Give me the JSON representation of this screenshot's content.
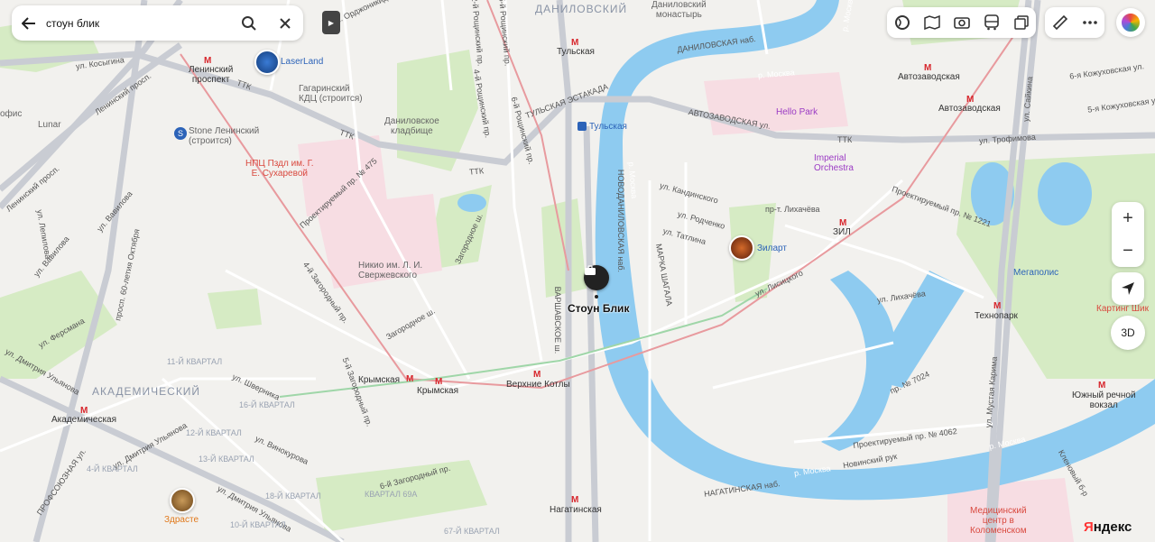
{
  "search": {
    "query": "стоун блик",
    "back_icon": "arrow-left-icon",
    "search_icon": "search-icon",
    "clear_icon": "close-icon"
  },
  "toolbar": {
    "items": [
      {
        "name": "layers-icon"
      },
      {
        "name": "panorama-icon"
      },
      {
        "name": "camera-icon"
      },
      {
        "name": "bus-icon"
      },
      {
        "name": "map-layers-icon"
      },
      {
        "name": "ruler-icon"
      },
      {
        "name": "more-icon"
      }
    ]
  },
  "controls": {
    "zoom_in": "+",
    "zoom_out": "−",
    "btn_3d": "3D"
  },
  "brand": {
    "logo_ya": "Я",
    "logo_rest": "ндекс"
  },
  "selected_place": {
    "name": "Стоун Блик"
  },
  "districts": {
    "danilovsky": "ДАНИЛОВСКИЙ",
    "akademichesky": "АКАДЕМИЧЕСКИЙ"
  },
  "metro": {
    "tulskaya": "Тульская",
    "leninsky": "Ленинский\nпроспект",
    "avtozavodskaya1": "Автозаводская",
    "avtozavodskaya2": "Автозаводская",
    "tulskaya_mcd": "Тульская",
    "zil": "ЗИЛ",
    "krymskaya1": "Крымская",
    "krymskaya2": "Крымская",
    "verkhnie_kotly": "Верхние Котлы",
    "akademicheskaya": "Академическая",
    "nagatinskaya": "Нагатинская",
    "tekhnopark": "Технопарк",
    "yuzhny": "Южный речной\nвокзал"
  },
  "pois": {
    "laserland": "LaserLand",
    "gagarinsky": "Гагаринский\nКДЦ (строится)",
    "danilovskoe": "Даниловское\nкладбище",
    "stone": "Stone Ленинский\n(строится)",
    "npc": "НПЦ Пздл им. Г.\nЕ. Сухаревой",
    "lunar": "Lunar",
    "nikio": "Никио им. Л. И.\nСвержевского",
    "hello_park": "Hello Park",
    "imperial": "Imperial\nOrchestra",
    "zilart": "Зиларт",
    "megapolis": "Мегаполис",
    "karting": "Картинг Шик",
    "zdraste": "Здрасте",
    "monastery": "Даниловский\nмонастырь",
    "medcenter": "Медицинский\nцентр в\nКоломенском",
    "ofis": "офис"
  },
  "streets": {
    "kosmygina": "ул. Косыгина",
    "leninsky_pr": "Ленинский просп.",
    "leninsky_pr2": "Ленинский просп.",
    "ttk1": "ТТК",
    "ttk2": "ТТК",
    "ttk3": "ТТК",
    "ttk4": "ТТК",
    "vavilova": "ул. Вавилова",
    "vavilova2": "ул. Вавилова",
    "ryabinovaya": "ул. Лепилова",
    "ordzhonikidze": "ул. Орджоникидзе",
    "ordzhonikidze2": "ул. Орджоникидзе",
    "shabolovka": "Шаболовка",
    "roshchinsky2": "2-й Рощинский пр.",
    "roshchinsky4": "4-й Рощинский пр.",
    "roshchinsky5": "5-й Рощинский пр.",
    "roshchinsky6": "6-й Рощинский пр.",
    "danilovskaya_nab": "ДАНИЛОВСКАЯ наб.",
    "tulskaya_estakada": "ТУЛЬСКАЯ ЭСТАКАДА",
    "avtozavodskaya_ul": "АВТОЗАВОДСКАЯ ул.",
    "kozhukhovskaya6": "6-я Кожуховская ул.",
    "kozhukhovskaya5": "5-я Кожуховская ул.",
    "trofimova": "ул. Трофимова",
    "lobachevskogo": "Проектируемый пр. № 475",
    "zagorodny4": "4-й Загородный пр.",
    "zagorodnoe": "Загородное ш.",
    "zagorodnoe2": "Загородное ш.",
    "zagorodny3": "3-й Загородный пр.",
    "zagorodny6": "6-й Загородный пр.",
    "zagorodny5": "5-й Загородный пр.",
    "novodanilovskaya": "НОВОДАНИЛОВСКАЯ наб.",
    "varshavskoe": "ВАРШАВСКОЕ ш.",
    "marka_shagala": "МАРКА ШАГАЛА",
    "marka_shagala2": "наб. Марка Шагала",
    "marka_shagala3": "наб. Марка Шагала",
    "kandinskogo": "ул. Кандинского",
    "rodchenko": "ул. Родченко",
    "tatlina": "ул. Татлина",
    "likhacheva": "пр-т. Лихачёва",
    "likhacheva2": "ул. Лихачёва",
    "lisitskogo": "ул. Лисицкого",
    "proekt1221": "Проектируемый пр. № 1221",
    "proekt7024": "пр. № 7024",
    "proekt4062": "Проектируемый пр. № 4062",
    "sayakina": "ул. Сайкина",
    "mustaya": "ул. Мустая Карима",
    "nagatinskaya_nab": "НАГАТИНСКАЯ наб.",
    "novinsky": "Новинский рук",
    "moskva1": "р. Москва",
    "moskva2": "р. Москва",
    "moskva3": "р. Москва",
    "moskva4": "р. Москва",
    "moskva5": "р. Москва",
    "klenovy": "Кленовый б-р",
    "profsoyuznaya": "ПРОФСОЮЗНАЯ ул.",
    "oktyabrya": "просп. 60-летия Октября",
    "dm_ulyanova": "ул. Дмитрия Ульянова",
    "dm_ulyanova2": "ул. Дмитрия Ульянова",
    "dm_ulyanova3": "ул. Дмитрия Ульянова",
    "fersmana": "ул. Ферсмана",
    "shvernika": "ул. Шверника",
    "vinokurova": "ул. Винокурова",
    "krasikova": "ул. Красикова",
    "ulyanova": "ул. Ульянова",
    "kv11": "11-Й КВАРТАЛ",
    "kv12": "12-Й КВАРТАЛ",
    "kv13": "13-Й КВАРТАЛ",
    "kv4": "4-Й КВАРТАЛ",
    "kv18": "18-Й КВАРТАЛ",
    "kv69a": "КВАРТАЛ 69А",
    "kv67": "67-Й КВАРТАЛ",
    "kv16": "16-Й КВАРТАЛ",
    "kv10": "10-Й КВАРТАЛ"
  }
}
